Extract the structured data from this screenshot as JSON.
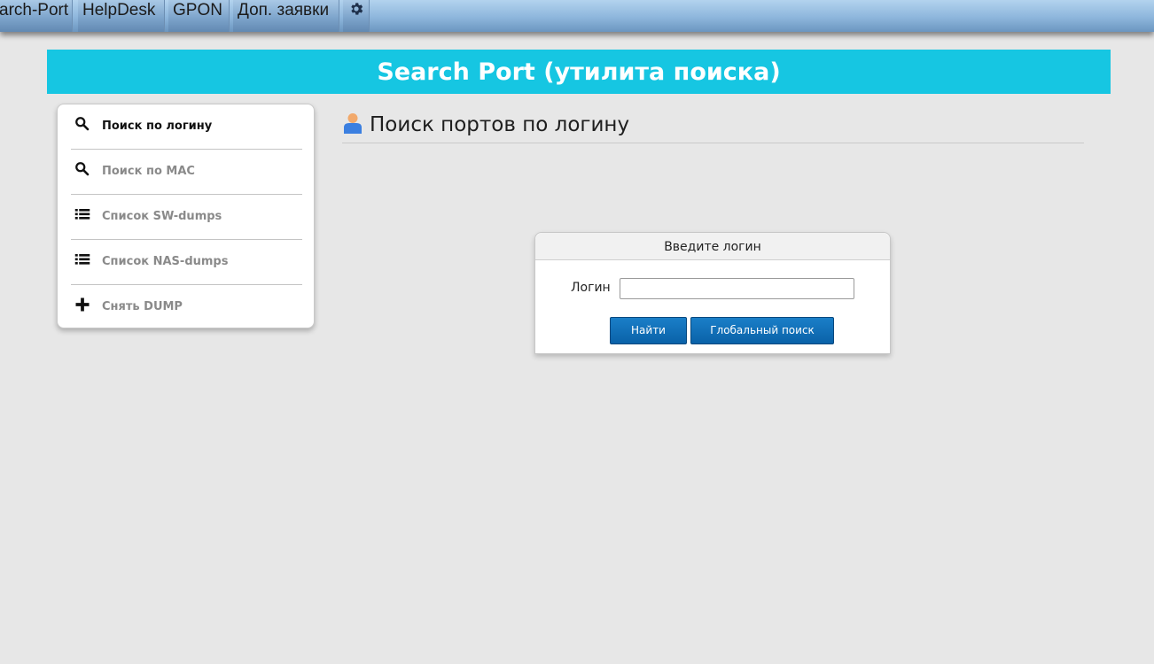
{
  "nav": {
    "tabs": [
      {
        "label": "arch-Port"
      },
      {
        "label": "HelpDesk"
      },
      {
        "label": "GPON"
      },
      {
        "label": "Доп. заявки"
      }
    ],
    "settings_icon": "gear-icon"
  },
  "banner": {
    "title": "Search Port (утилита поиска)"
  },
  "sidebar": {
    "items": [
      {
        "label": "Поиск по логину",
        "icon": "search-icon",
        "active": true
      },
      {
        "label": "Поиск по MAC",
        "icon": "search-icon",
        "active": false
      },
      {
        "label": "Список SW-dumps",
        "icon": "list-icon",
        "active": false
      },
      {
        "label": "Список NAS-dumps",
        "icon": "list-icon",
        "active": false
      },
      {
        "label": "Снять DUMP",
        "icon": "plus-icon",
        "active": false
      }
    ]
  },
  "page": {
    "title": "Поиск портов по логину",
    "icon": "user-icon"
  },
  "login_panel": {
    "header": "Введите логин",
    "field_label": "Логин",
    "field_value": "",
    "find_button": "Найти",
    "global_button": "Глобальный поиск"
  },
  "colors": {
    "banner": "#16c6e2",
    "button": "#0a62a8",
    "background": "#e7e7e7"
  }
}
